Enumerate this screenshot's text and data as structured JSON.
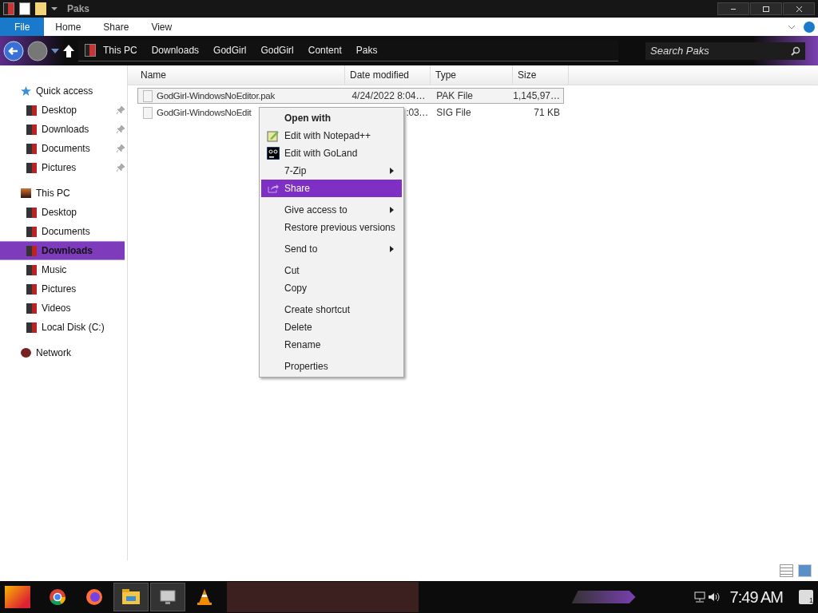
{
  "window": {
    "title": "Paks"
  },
  "ribbon_tabs": [
    {
      "label": "File",
      "selected": true
    },
    {
      "label": "Home",
      "selected": false
    },
    {
      "label": "Share",
      "selected": false
    },
    {
      "label": "View",
      "selected": false
    }
  ],
  "breadcrumb": [
    "This PC",
    "Downloads",
    "GodGirl",
    "GodGirl",
    "Content",
    "Paks"
  ],
  "search": {
    "placeholder": "Search Paks"
  },
  "sidebar": [
    {
      "label": "Quick access",
      "children": [
        {
          "label": "Desktop",
          "pinned": true,
          "selected": false
        },
        {
          "label": "Downloads",
          "pinned": true,
          "selected": false
        },
        {
          "label": "Documents",
          "pinned": true,
          "selected": false
        },
        {
          "label": "Pictures",
          "pinned": true,
          "selected": false
        }
      ]
    },
    {
      "label": "This PC",
      "children": [
        {
          "label": "Desktop",
          "pinned": false,
          "selected": false
        },
        {
          "label": "Documents",
          "pinned": false,
          "selected": false
        },
        {
          "label": "Downloads",
          "pinned": false,
          "selected": true
        },
        {
          "label": "Music",
          "pinned": false,
          "selected": false
        },
        {
          "label": "Pictures",
          "pinned": false,
          "selected": false
        },
        {
          "label": "Videos",
          "pinned": false,
          "selected": false
        },
        {
          "label": "Local Disk (C:)",
          "pinned": false,
          "selected": false
        }
      ]
    },
    {
      "label": "Network"
    }
  ],
  "table": {
    "columns": [
      "Name",
      "Date modified",
      "Type",
      "Size"
    ],
    "rows": [
      {
        "name": "GodGirl-WindowsNoEditor.pak",
        "date": "4/24/2022 8:04…",
        "type": "PAK File",
        "size": "1,145,97…",
        "selected": true,
        "kind": "plain"
      },
      {
        "name": "GodGirl-WindowsNoEdit",
        "date": ":03…",
        "type": "SIG File",
        "size": "71 KB",
        "selected": false,
        "kind": "covered"
      }
    ]
  },
  "context_menu": [
    {
      "items": [
        {
          "label": "Open with",
          "kind": "default",
          "submenu": false,
          "selected": false
        },
        {
          "label": "Edit with Notepad++",
          "kind": "notepad",
          "submenu": false,
          "selected": false
        },
        {
          "label": "Edit with GoLand",
          "kind": "goland",
          "submenu": false,
          "selected": false
        },
        {
          "label": "7-Zip",
          "kind": "item",
          "submenu": true,
          "selected": false
        },
        {
          "label": "Share",
          "kind": "share",
          "submenu": false,
          "selected": true
        }
      ]
    },
    {
      "items": [
        {
          "label": "Give access to",
          "kind": "item",
          "submenu": true,
          "selected": false
        },
        {
          "label": "Restore previous versions",
          "kind": "item",
          "submenu": false,
          "selected": false
        }
      ]
    },
    {
      "items": [
        {
          "label": "Send to",
          "kind": "item",
          "submenu": true,
          "selected": false
        }
      ]
    },
    {
      "items": [
        {
          "label": "Cut",
          "kind": "item",
          "submenu": false,
          "selected": false
        },
        {
          "label": "Copy",
          "kind": "item",
          "submenu": false,
          "selected": false
        }
      ]
    },
    {
      "items": [
        {
          "label": "Create shortcut",
          "kind": "item",
          "submenu": false,
          "selected": false
        },
        {
          "label": "Delete",
          "kind": "item",
          "submenu": false,
          "selected": false
        },
        {
          "label": "Rename",
          "kind": "item",
          "submenu": false,
          "selected": false
        }
      ]
    },
    {
      "items": [
        {
          "label": "Properties",
          "kind": "item",
          "submenu": false,
          "selected": false
        }
      ]
    }
  ],
  "taskbar": {
    "clock": "7:49 AM",
    "notifications": "1"
  }
}
